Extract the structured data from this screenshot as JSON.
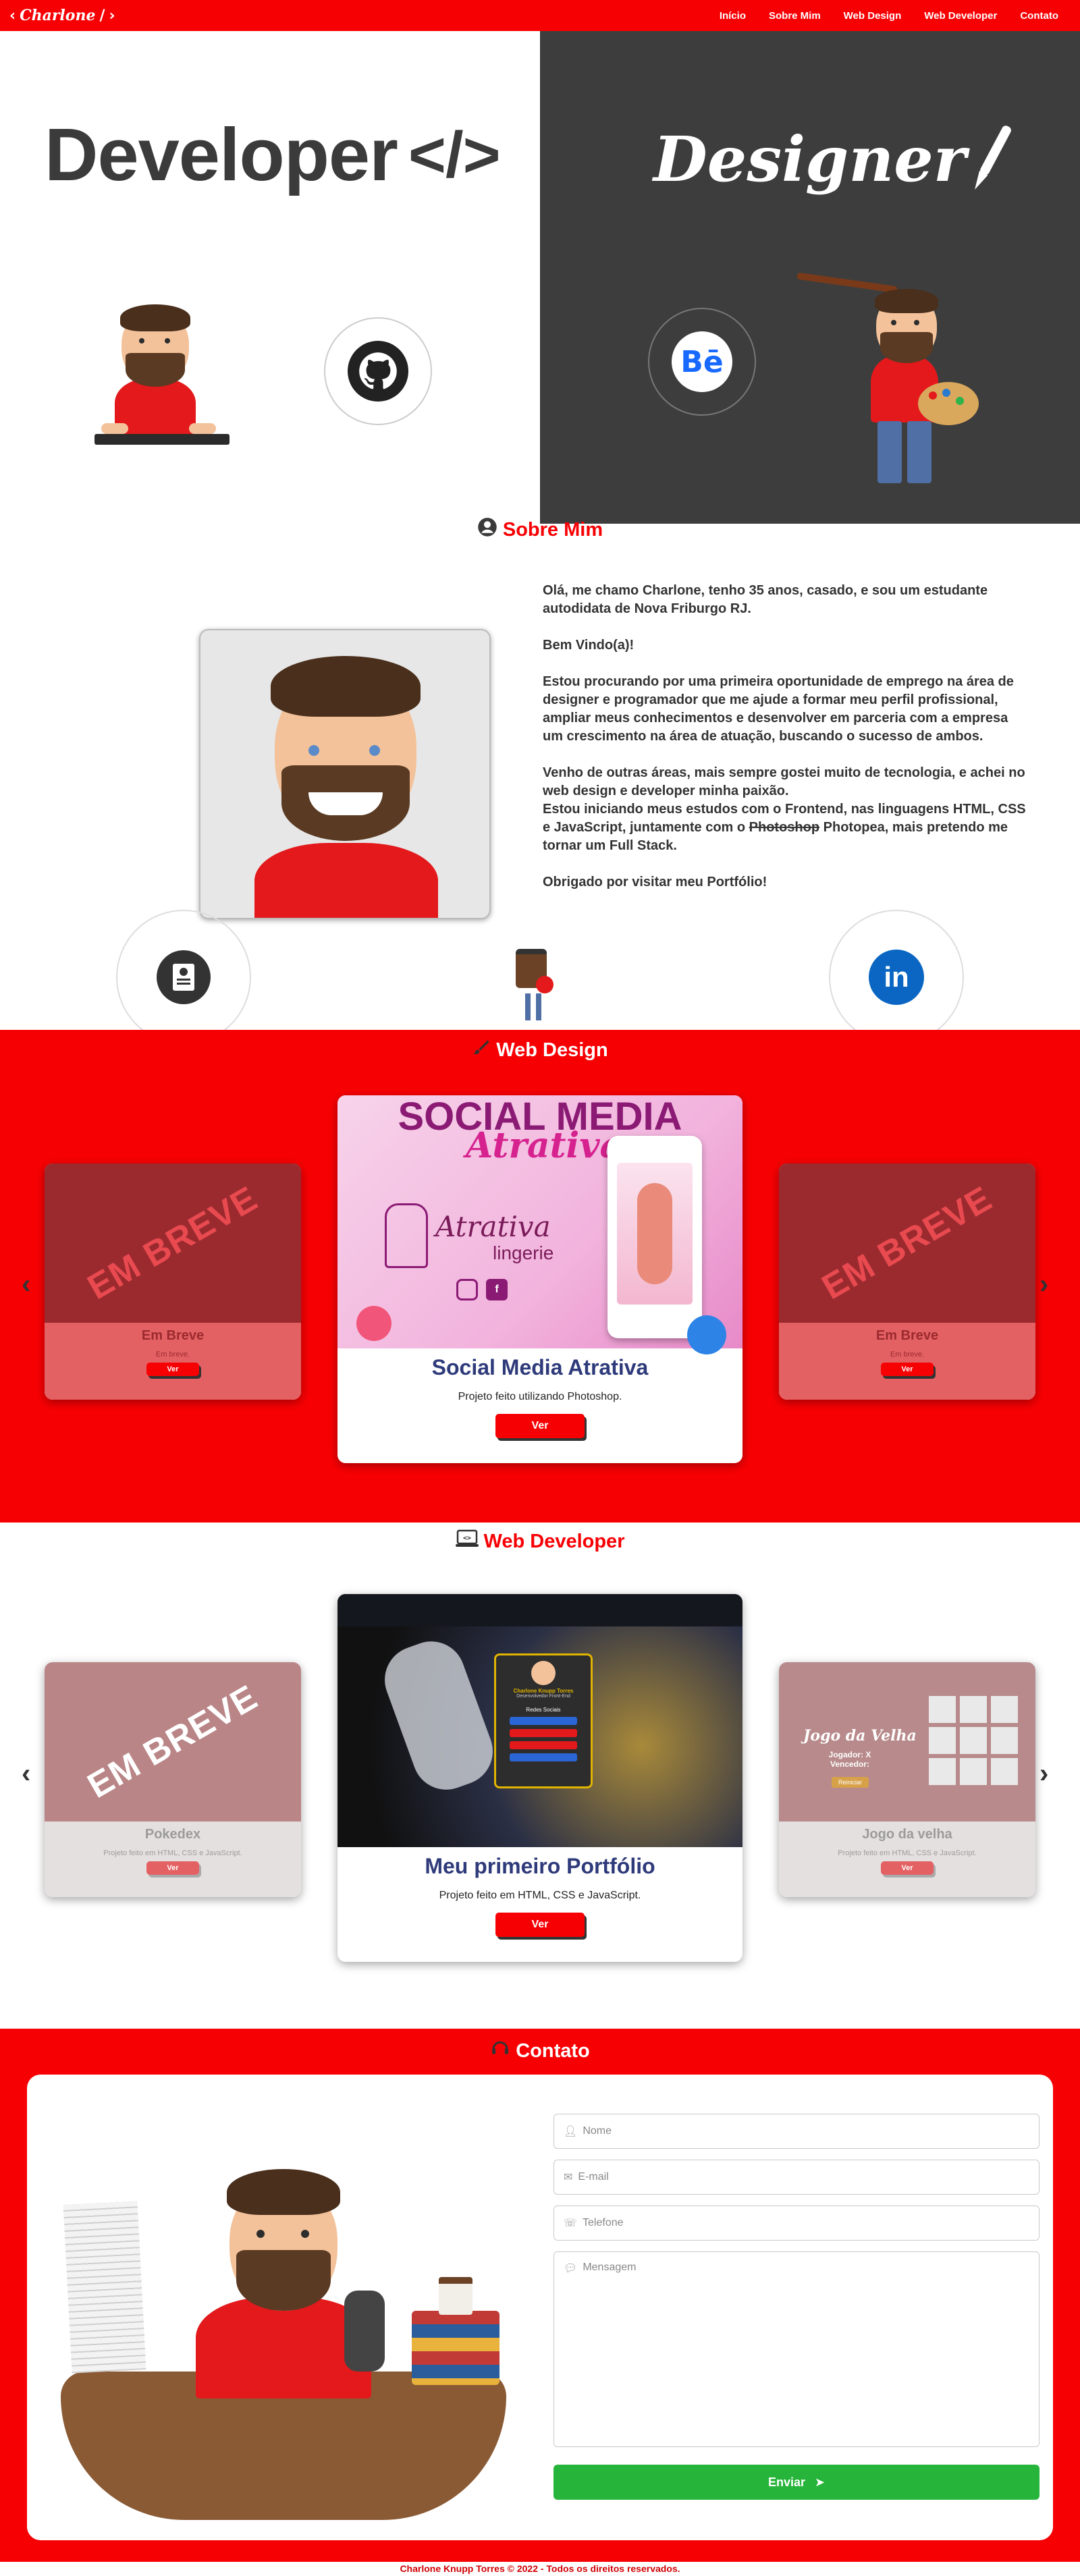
{
  "nav": {
    "logo": "Charlone",
    "links": [
      "Início",
      "Sobre Mim",
      "Web Design",
      "Web Developer",
      "Contato"
    ]
  },
  "hero": {
    "developer_title": "Developer",
    "developer_code_glyph": "</>",
    "designer_title": "Designer"
  },
  "sobre": {
    "title": "Sobre Mim",
    "paragraphs": [
      "Olá, me chamo Charlone, tenho 35 anos, casado, e sou um estudante autodidata de Nova Friburgo RJ.",
      "Bem Vindo(a)!",
      "Estou procurando por uma primeira oportunidade de emprego na área de designer e programador que me ajude a formar meu perfil profissional, ampliar meus conhecimentos e desenvolver em parceria com a empresa um crescimento na área de atuação, buscando o sucesso de ambos.",
      "Venho de outras áreas, mais sempre gostei muito de tecnologia, e achei no web design e developer minha paixão.",
      "Obrigado por visitar meu Portfólio!"
    ],
    "study_pre": "Estou iniciando meus estudos com o Frontend, nas linguagens HTML, CSS e JavaScript, juntamente com o ",
    "study_strike": "Photoshop",
    "study_post": " Photopea, mais pretendo me tornar um Full Stack."
  },
  "webdesign": {
    "title": "Web Design",
    "center": {
      "banner_line1": "SOCIAL MEDIA",
      "banner_line2": "Atrativa",
      "brand": "Atrativa",
      "brand_sub": "lingerie",
      "title": "Social Media Atrativa",
      "desc": "Projeto feito utilizando Photoshop.",
      "button": "Ver"
    },
    "left": {
      "stamp": "EM BREVE",
      "title": "Em Breve",
      "desc": "Em breve.",
      "button": "Ver"
    },
    "right": {
      "stamp": "EM BREVE",
      "title": "Em Breve",
      "desc": "Em breve.",
      "button": "Ver"
    }
  },
  "webdev": {
    "title": "Web Developer",
    "center": {
      "title": "Meu primeiro Portfólio",
      "desc": "Projeto feito em HTML, CSS e JavaScript.",
      "button": "Ver",
      "mock_name": "Charlone Knupp Torres",
      "mock_sub": "Desenvolvedor Front-End",
      "mock_section": "Redes Sociais"
    },
    "left": {
      "stamp": "EM BREVE",
      "title": "Pokedex",
      "desc": "Projeto feito em HTML, CSS e JavaScript.",
      "button": "Ver"
    },
    "right": {
      "game_title": "Jogo da Velha",
      "game_sub": "Jogador: X Vencedor:",
      "game_btn": "Reiniciar",
      "title": "Jogo da velha",
      "desc": "Projeto feito em HTML, CSS e JavaScript.",
      "button": "Ver"
    }
  },
  "contato": {
    "title": "Contato",
    "fields": {
      "name": "Nome",
      "email": "E-mail",
      "phone": "Telefone",
      "message": "Mensagem"
    },
    "send": "Enviar"
  },
  "footer": "Charlone Knupp Torres © 2022 - Todos os direitos reservados.",
  "colors": {
    "primary_red": "#f70004",
    "dark_gray": "#3d3d3d",
    "send_green": "#27b43a",
    "title_navy": "#2e3a7a"
  }
}
